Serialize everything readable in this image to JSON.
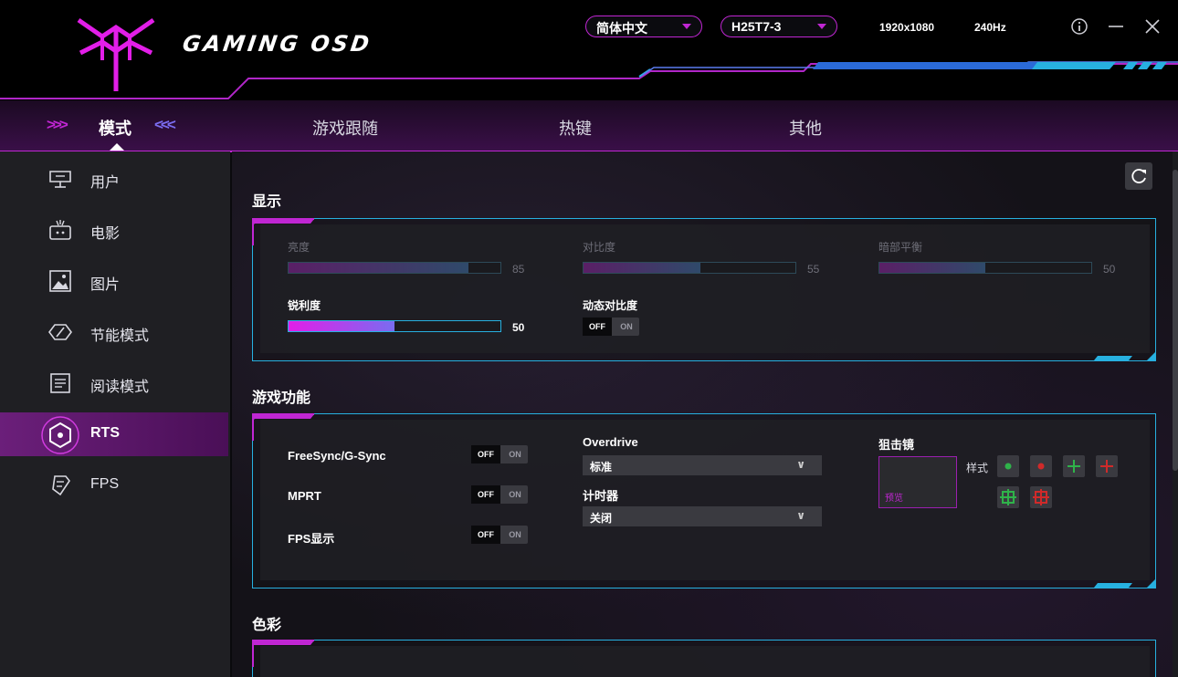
{
  "app": {
    "logo_text": "GAMING OSD"
  },
  "header": {
    "language": "简体中文",
    "model": "H25T7-3",
    "resolution": "1920x1080",
    "refresh_rate": "240Hz"
  },
  "tabs": [
    "模式",
    "游戏跟随",
    "热键",
    "其他"
  ],
  "active_tab": "模式",
  "sidebar": {
    "items": [
      {
        "label": "用户",
        "icon": "user-monitor-icon"
      },
      {
        "label": "电影",
        "icon": "movie-tv-icon"
      },
      {
        "label": "图片",
        "icon": "picture-icon"
      },
      {
        "label": "节能模式",
        "icon": "eco-icon"
      },
      {
        "label": "阅读模式",
        "icon": "reading-icon"
      },
      {
        "label": "RTS",
        "icon": "rts-hexagon-icon",
        "active": true
      },
      {
        "label": "FPS",
        "icon": "fps-icon"
      }
    ]
  },
  "display": {
    "title": "显示",
    "brightness": {
      "label": "亮度",
      "value": "85",
      "level": 85,
      "enabled": false
    },
    "contrast": {
      "label": "对比度",
      "value": "55",
      "level": 55,
      "enabled": false
    },
    "dark_balance": {
      "label": "暗部平衡",
      "value": "50",
      "level": 50,
      "enabled": false
    },
    "sharpness": {
      "label": "锐利度",
      "value": "50",
      "level": 50,
      "enabled": true
    },
    "dcr": {
      "label": "动态对比度",
      "off": "OFF",
      "on": "ON",
      "state": "OFF"
    }
  },
  "game": {
    "title": "游戏功能",
    "freesync": {
      "label": "FreeSync/G-Sync",
      "off": "OFF",
      "on": "ON",
      "state": "OFF"
    },
    "mprt": {
      "label": "MPRT",
      "off": "OFF",
      "on": "ON",
      "state": "OFF"
    },
    "fps_display": {
      "label": "FPS显示",
      "off": "OFF",
      "on": "ON",
      "state": "OFF"
    },
    "overdrive": {
      "label": "Overdrive",
      "value": "标准"
    },
    "timer": {
      "label": "计时器",
      "value": "关闭"
    },
    "crosshair": {
      "label": "狙击镜",
      "preview": "预览",
      "style_label": "样式"
    }
  },
  "color": {
    "title": "色彩"
  },
  "colors": {
    "accent_magenta": "#c026d3",
    "accent_cyan": "#27b0e0",
    "green": "#2fb34a",
    "red": "#d02a2a"
  }
}
